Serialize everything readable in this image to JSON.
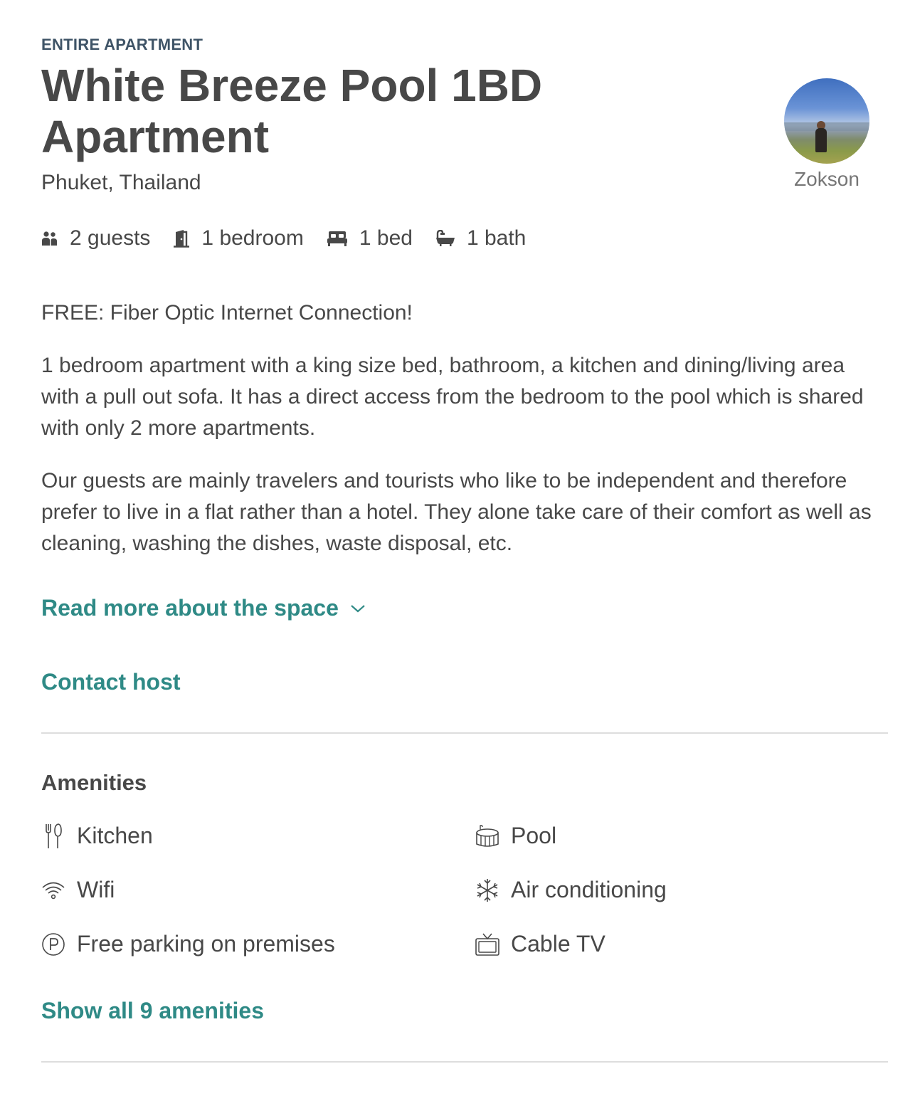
{
  "listing": {
    "type_label": "ENTIRE APARTMENT",
    "title": "White Breeze Pool 1BD Apartment",
    "location": "Phuket, Thailand"
  },
  "host": {
    "name": "Zokson"
  },
  "facts": [
    {
      "icon": "guests-icon",
      "label": "2 guests"
    },
    {
      "icon": "door-icon",
      "label": "1 bedroom"
    },
    {
      "icon": "bed-icon",
      "label": "1 bed"
    },
    {
      "icon": "bathtub-icon",
      "label": "1 bath"
    }
  ],
  "description": {
    "p1": "FREE: Fiber Optic Internet Connection!",
    "p2": "1 bedroom apartment with a king size bed, bathroom, a kitchen and dining/living area with a pull out sofa. It has a direct access from the bedroom to the pool which is shared with only 2 more apartments.",
    "p3": "Our guests are mainly travelers and tourists who like to be independent and therefore prefer to live in a flat rather than a hotel. They alone take care of their comfort as well as cleaning, washing the dishes, waste disposal, etc.",
    "read_more": "Read more about the space"
  },
  "contact_host": "Contact host",
  "amenities": {
    "title": "Amenities",
    "items": [
      {
        "icon": "kitchen-icon",
        "label": "Kitchen"
      },
      {
        "icon": "pool-icon",
        "label": "Pool"
      },
      {
        "icon": "wifi-icon",
        "label": "Wifi"
      },
      {
        "icon": "snowflake-icon",
        "label": "Air conditioning"
      },
      {
        "icon": "parking-icon",
        "label": "Free parking on premises"
      },
      {
        "icon": "tv-icon",
        "label": "Cable TV"
      }
    ],
    "show_all": "Show all 9 amenities"
  },
  "colors": {
    "link": "#2f8a86",
    "text": "#484848",
    "eyebrow": "#3f5467"
  }
}
